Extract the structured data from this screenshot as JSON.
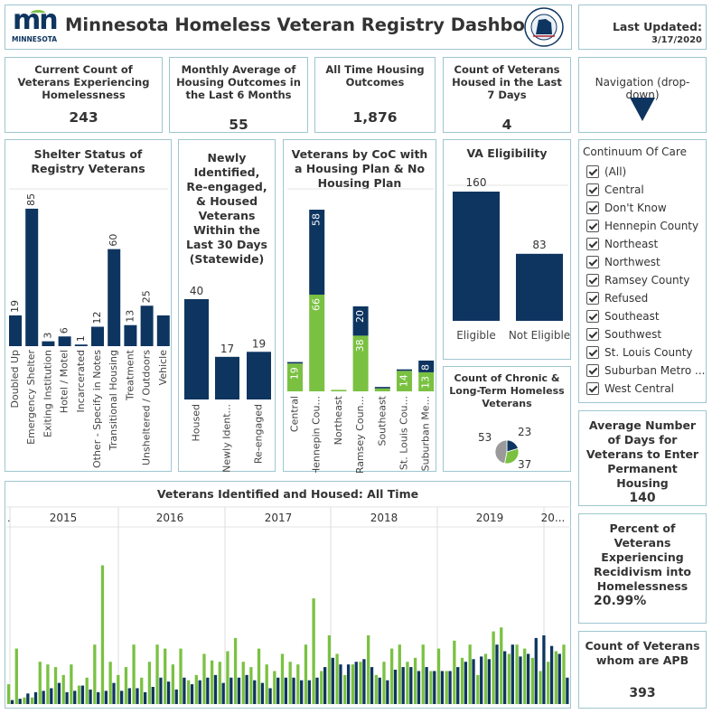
{
  "header": {
    "logo_text": "mn",
    "logo_subtext": "MINNESOTA",
    "title": "Minnesota Homeless Veteran Registry Dashboard",
    "seal_text": "MINNESOTA DEPARTMENT OF VETERANS AFFAIRS"
  },
  "last_updated": {
    "label": "Last Updated:",
    "date": "3/17/2020"
  },
  "kpis": [
    {
      "title": "Current Count of Veterans Experiencing Homelessness",
      "value": "243"
    },
    {
      "title": "Monthly Average of Housing Outcomes in the Last 6 Months",
      "value": "55"
    },
    {
      "title": "All Time Housing Outcomes",
      "value": "1,876"
    },
    {
      "title": "Count of Veterans Housed in the Last 7 Days",
      "value": "4"
    }
  ],
  "navigation": {
    "label": "Navigation (drop-down)"
  },
  "filter": {
    "title": "Continuum Of Care",
    "items": [
      "(All)",
      "Central",
      "Don't Know",
      "Hennepin County",
      "Northeast",
      "Northwest",
      "Ramsey County",
      "Refused",
      "Southeast",
      "Southwest",
      "St. Louis County",
      "Suburban Metro ...",
      "West Central"
    ]
  },
  "side_kpis": [
    {
      "title": "Average Number of Days for Veterans to Enter Permanent Housing",
      "value": "140"
    },
    {
      "title": "Percent of Veterans Experiencing Recidivism into Homelessness",
      "value": "20.99%"
    },
    {
      "title": "Count of Veterans whom are APB",
      "value": "393"
    }
  ],
  "colors": {
    "navy": "#0e3560",
    "green": "#7ac142",
    "grey": "#9a9a9a",
    "border": "#9fc6cf"
  },
  "chart_data": [
    {
      "type": "bar",
      "title": "Shelter Status of Registry Veterans",
      "categories": [
        "Doubled Up",
        "Emergency Shelter",
        "Exiting Institution",
        "Hotel / Motel",
        "Incarcerated",
        "Other - Specify in Notes",
        "Transitional Housing",
        "Treatment",
        "Unsheltered / Outdoors",
        "Vehicle"
      ],
      "values": [
        19,
        85,
        3,
        6,
        1,
        12,
        60,
        13,
        25,
        19
      ],
      "labels": [
        "19",
        "85",
        "3",
        "6",
        "1",
        "12",
        "60",
        "13",
        "25",
        ""
      ],
      "ylim": [
        0,
        95
      ]
    },
    {
      "type": "bar",
      "title": "Newly Identified, Re-engaged, & Housed Veterans Within the Last 30 Days (Statewide)",
      "categories": [
        "Housed",
        "Newly Ident...",
        "Re-engaged"
      ],
      "values": [
        40,
        17,
        19
      ],
      "ylim": [
        0,
        50
      ]
    },
    {
      "type": "bar",
      "title": "Veterans by CoC with a Housing Plan & No Housing Plan",
      "categories": [
        "Central",
        "Hennepin Cou...",
        "Northeast",
        "Ramsey Coun...",
        "Southeast",
        "St. Louis Cou...",
        "Suburban Me..."
      ],
      "series": [
        {
          "values": [
            19,
            66,
            1,
            38,
            2,
            14,
            13
          ],
          "labels": [
            "19",
            "66",
            "",
            "38",
            "",
            "14",
            "13"
          ]
        },
        {
          "values": [
            1,
            58,
            0,
            20,
            1,
            1,
            8
          ],
          "labels": [
            "",
            "58",
            "",
            "20",
            "",
            "",
            "8"
          ]
        }
      ],
      "ylim": [
        0,
        140
      ]
    },
    {
      "type": "bar",
      "title": "VA Eligibility",
      "categories": [
        "Eligible",
        "Not Eligible"
      ],
      "values": [
        160,
        83
      ],
      "ylim": [
        0,
        190
      ]
    },
    {
      "type": "pie",
      "title": "Count of Chronic & Long-Term Homeless Veterans",
      "values": [
        23,
        37,
        53
      ]
    },
    {
      "type": "bar",
      "title": "Veterans Identified and Housed: All Time",
      "x_groups": [
        "2015",
        "2016",
        "2017",
        "2018",
        "2019",
        "20..."
      ],
      "series": [
        {
          "values": [
            15,
            42,
            5,
            5,
            32,
            30,
            28,
            22,
            30,
            14,
            20,
            45,
            105,
            32,
            22,
            28,
            45,
            20,
            32,
            45,
            42,
            30,
            42,
            18,
            22,
            38,
            33,
            32,
            40,
            50,
            32,
            28,
            42,
            30,
            25,
            38,
            32,
            30,
            45,
            80,
            25,
            52,
            38,
            22,
            30,
            32,
            52,
            22,
            32,
            42,
            45,
            32,
            35,
            45,
            25,
            42,
            25,
            48,
            35,
            45,
            22,
            38,
            55,
            58,
            38,
            45,
            42,
            35,
            25,
            32,
            40,
            45
          ]
        },
        {
          "values": [
            3,
            4,
            8,
            9,
            10,
            12,
            16,
            9,
            10,
            14,
            11,
            9,
            10,
            16,
            10,
            12,
            12,
            9,
            13,
            20,
            17,
            11,
            20,
            15,
            18,
            20,
            22,
            16,
            20,
            20,
            22,
            18,
            16,
            12,
            20,
            20,
            20,
            18,
            18,
            20,
            28,
            35,
            30,
            30,
            32,
            34,
            28,
            20,
            18,
            26,
            28,
            28,
            25,
            28,
            25,
            25,
            25,
            28,
            32,
            34,
            36,
            34,
            45,
            40,
            45,
            36,
            38,
            50,
            52,
            44,
            38,
            20
          ]
        }
      ],
      "ylim": [
        0,
        130
      ]
    }
  ]
}
